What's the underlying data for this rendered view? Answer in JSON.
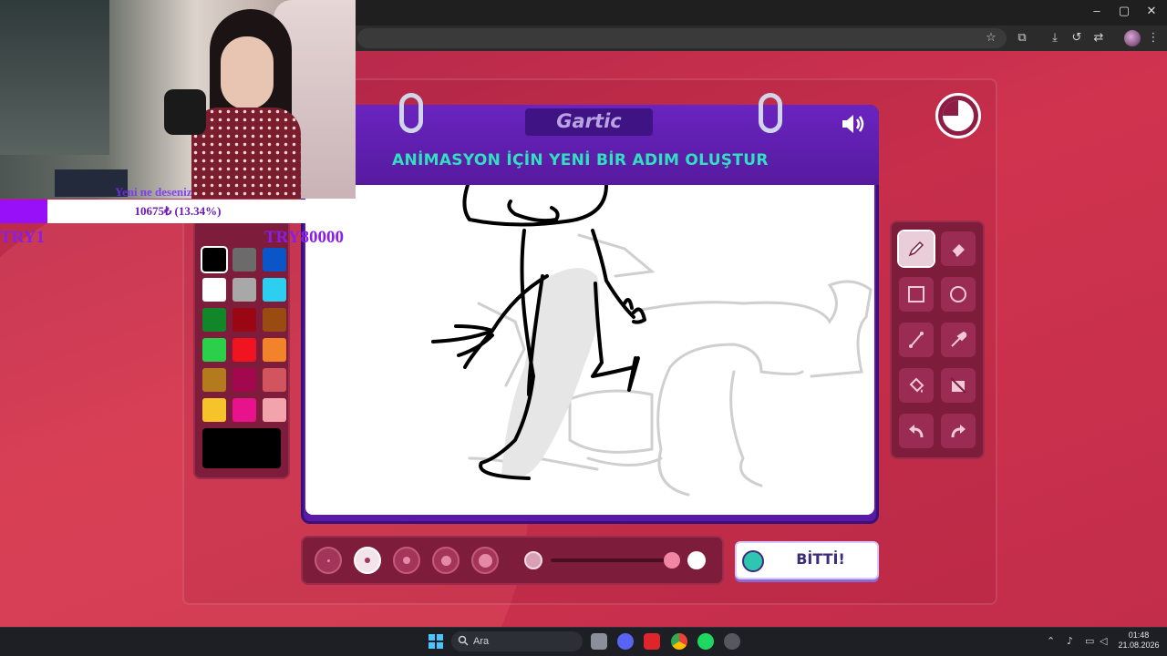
{
  "browser": {
    "window_controls": {
      "minimize": "–",
      "maximize": "▢",
      "close": "✕"
    }
  },
  "stream": {
    "cam_caption": "Yeni ne deseniz",
    "donation_text": "10675₺ (13.34%)",
    "donation_progress": 0.1334,
    "goal_left": "TRY1",
    "goal_right": "TRY80000",
    "accent_color": "#9810f7"
  },
  "game": {
    "logo": "Gartic",
    "instruction": "ANİMASYON İÇİN YENİ BİR ADIM OLUŞTUR",
    "done_label": "BİTTİ!",
    "selected_color": "#000000",
    "selected_tool": "pencil",
    "selected_size_index": 1,
    "opacity_level": 0.95,
    "palette": [
      [
        "#000000",
        "#6b6b6b",
        "#0a55c7"
      ],
      [
        "#ffffff",
        "#a8a8a8",
        "#2dcff0"
      ],
      [
        "#12872a",
        "#9a0712",
        "#9a4b12"
      ],
      [
        "#2bcf4a",
        "#ef1420",
        "#f2832a"
      ],
      [
        "#b37a1e",
        "#a3084f",
        "#d1545f"
      ],
      [
        "#f6c42a",
        "#e8138c",
        "#f2a3ab"
      ]
    ],
    "tools": [
      "pencil-icon",
      "eraser-icon",
      "rectangle-icon",
      "ellipse-icon",
      "line-icon",
      "eyedropper-icon",
      "fill-icon",
      "no-fill-icon",
      "undo-icon",
      "redo-icon"
    ]
  },
  "taskbar": {
    "search_placeholder": "Ara",
    "time": "01:48",
    "date": "21.08.2026"
  }
}
